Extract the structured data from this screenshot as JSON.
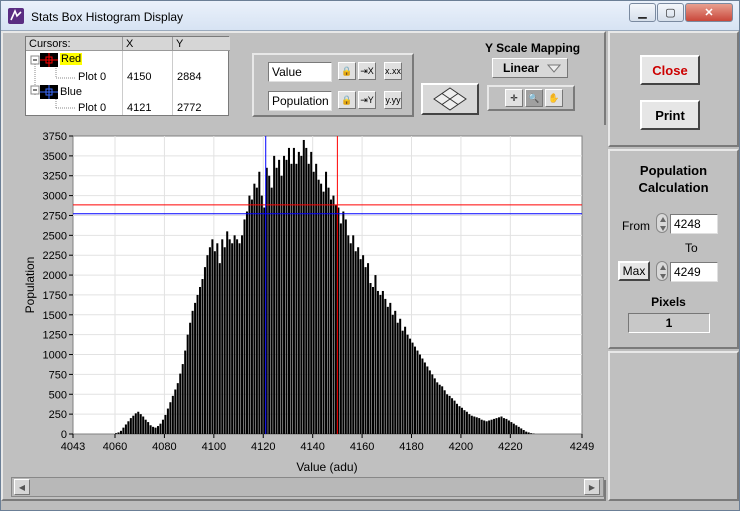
{
  "window": {
    "title": "Stats Box Histogram Display",
    "minimize": "▁",
    "maximize": "▢",
    "close": "✕"
  },
  "cursors": {
    "header": {
      "name": "Cursors:",
      "x": "X",
      "y": "Y"
    },
    "items": [
      {
        "name": "Red",
        "color": "#ff0000",
        "plot": "Plot 0",
        "x": "4150",
        "y": "2884"
      },
      {
        "name": "Blue",
        "color": "#0000ff",
        "plot": "Plot 0",
        "x": "4121",
        "y": "2772"
      }
    ]
  },
  "axis_controls": {
    "x_label": "Value",
    "y_label": "Population",
    "x_fmt": "x.xx",
    "y_fmt": "y.yy"
  },
  "y_scale": {
    "title": "Y Scale Mapping",
    "selected": "Linear"
  },
  "buttons": {
    "close": "Close",
    "print": "Print"
  },
  "population": {
    "title_line1": "Population",
    "title_line2": "Calculation",
    "from_label": "From",
    "from_value": "4248",
    "to_label": "To",
    "max_button": "Max",
    "to_value": "4249",
    "pixels_label": "Pixels",
    "pixels_value": "1"
  },
  "colors": {
    "red_cursor": "#ff0000",
    "blue_cursor": "#0000ff",
    "close_text": "#cc0000"
  },
  "chart_data": {
    "type": "bar",
    "xlabel": "Value (adu)",
    "ylabel": "Population",
    "xlim": [
      4043,
      4249
    ],
    "ylim": [
      0,
      3750
    ],
    "x_ticks": [
      "4043",
      "4060",
      "4080",
      "4100",
      "4120",
      "4140",
      "4160",
      "4180",
      "4200",
      "4220",
      "4249"
    ],
    "x_tick_values": [
      4043,
      4060,
      4080,
      4100,
      4120,
      4140,
      4160,
      4180,
      4200,
      4220,
      4249
    ],
    "y_ticks": [
      "0",
      "250",
      "500",
      "750",
      "1000",
      "1250",
      "1500",
      "1750",
      "2000",
      "2250",
      "2500",
      "2750",
      "3000",
      "3250",
      "3500",
      "3750"
    ],
    "y_tick_values": [
      0,
      250,
      500,
      750,
      1000,
      1250,
      1500,
      1750,
      2000,
      2250,
      2500,
      2750,
      3000,
      3250,
      3500,
      3750
    ],
    "grid": true,
    "x": [
      4043,
      4044,
      4045,
      4046,
      4047,
      4048,
      4049,
      4050,
      4051,
      4052,
      4053,
      4054,
      4055,
      4056,
      4057,
      4058,
      4059,
      4060,
      4061,
      4062,
      4063,
      4064,
      4065,
      4066,
      4067,
      4068,
      4069,
      4070,
      4071,
      4072,
      4073,
      4074,
      4075,
      4076,
      4077,
      4078,
      4079,
      4080,
      4081,
      4082,
      4083,
      4084,
      4085,
      4086,
      4087,
      4088,
      4089,
      4090,
      4091,
      4092,
      4093,
      4094,
      4095,
      4096,
      4097,
      4098,
      4099,
      4100,
      4101,
      4102,
      4103,
      4104,
      4105,
      4106,
      4107,
      4108,
      4109,
      4110,
      4111,
      4112,
      4113,
      4114,
      4115,
      4116,
      4117,
      4118,
      4119,
      4120,
      4121,
      4122,
      4123,
      4124,
      4125,
      4126,
      4127,
      4128,
      4129,
      4130,
      4131,
      4132,
      4133,
      4134,
      4135,
      4136,
      4137,
      4138,
      4139,
      4140,
      4141,
      4142,
      4143,
      4144,
      4145,
      4146,
      4147,
      4148,
      4149,
      4150,
      4151,
      4152,
      4153,
      4154,
      4155,
      4156,
      4157,
      4158,
      4159,
      4160,
      4161,
      4162,
      4163,
      4164,
      4165,
      4166,
      4167,
      4168,
      4169,
      4170,
      4171,
      4172,
      4173,
      4174,
      4175,
      4176,
      4177,
      4178,
      4179,
      4180,
      4181,
      4182,
      4183,
      4184,
      4185,
      4186,
      4187,
      4188,
      4189,
      4190,
      4191,
      4192,
      4193,
      4194,
      4195,
      4196,
      4197,
      4198,
      4199,
      4200,
      4201,
      4202,
      4203,
      4204,
      4205,
      4206,
      4207,
      4208,
      4209,
      4210,
      4211,
      4212,
      4213,
      4214,
      4215,
      4216,
      4217,
      4218,
      4219,
      4220,
      4221,
      4222,
      4223,
      4224,
      4225,
      4226,
      4227,
      4228,
      4229,
      4230,
      4231,
      4232,
      4233,
      4234,
      4235,
      4236,
      4237,
      4238,
      4239,
      4240,
      4241,
      4242,
      4243,
      4244,
      4245,
      4246,
      4247,
      4248
    ],
    "values": [
      0,
      0,
      0,
      0,
      0,
      0,
      0,
      0,
      0,
      0,
      0,
      0,
      0,
      0,
      0,
      0,
      0,
      10,
      20,
      40,
      80,
      120,
      160,
      200,
      230,
      260,
      280,
      250,
      220,
      180,
      150,
      110,
      90,
      80,
      100,
      130,
      180,
      240,
      320,
      400,
      480,
      560,
      640,
      760,
      880,
      1050,
      1250,
      1400,
      1550,
      1650,
      1750,
      1850,
      1950,
      2100,
      2250,
      2350,
      2450,
      2300,
      2400,
      2150,
      2450,
      2350,
      2550,
      2450,
      2400,
      2500,
      2450,
      2400,
      2500,
      2700,
      2800,
      3000,
      2950,
      3150,
      3100,
      3300,
      3000,
      2850,
      3350,
      3250,
      3100,
      3500,
      3350,
      3450,
      3250,
      3500,
      3450,
      3600,
      3400,
      3600,
      3400,
      3550,
      3500,
      3700,
      3600,
      3400,
      3550,
      3300,
      3400,
      3200,
      3150,
      3050,
      3300,
      3100,
      2950,
      3000,
      2880,
      2850,
      2650,
      2800,
      2700,
      2500,
      2400,
      2500,
      2300,
      2350,
      2200,
      2250,
      2100,
      2150,
      1900,
      1850,
      2000,
      1800,
      1750,
      1800,
      1700,
      1600,
      1650,
      1500,
      1550,
      1400,
      1450,
      1300,
      1350,
      1250,
      1200,
      1150,
      1100,
      1050,
      1000,
      950,
      900,
      850,
      800,
      750,
      700,
      650,
      620,
      600,
      550,
      500,
      480,
      450,
      420,
      380,
      350,
      330,
      300,
      280,
      250,
      230,
      220,
      210,
      200,
      180,
      170,
      160,
      170,
      180,
      190,
      200,
      210,
      220,
      200,
      190,
      170,
      150,
      130,
      110,
      90,
      70,
      50,
      30,
      20,
      10,
      5,
      0,
      0,
      0,
      0,
      0,
      0,
      0,
      0,
      0,
      0,
      0,
      0,
      0,
      0,
      0
    ],
    "cursors": [
      {
        "name": "Red",
        "x": 4150,
        "y": 2884
      },
      {
        "name": "Blue",
        "x": 4121,
        "y": 2772
      }
    ]
  }
}
